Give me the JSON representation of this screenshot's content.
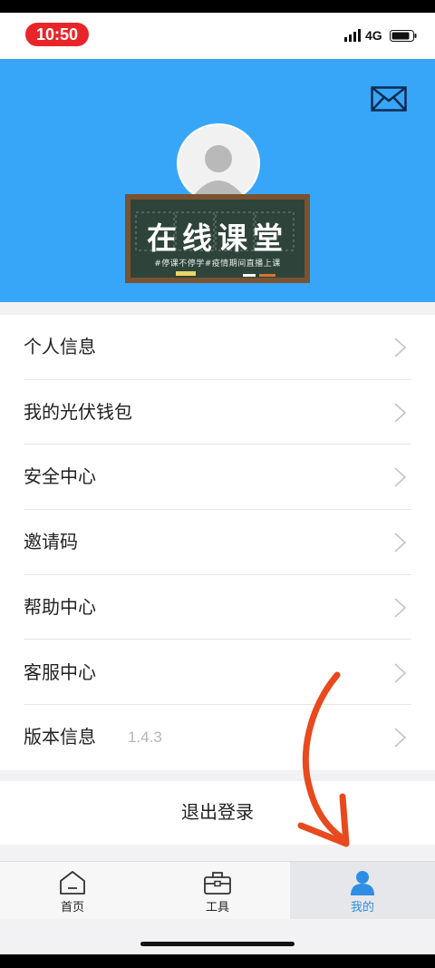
{
  "status_bar": {
    "time": "10:50",
    "network": "4G"
  },
  "header": {
    "banner_title": "在线课堂",
    "banner_subtitle": "#停课不停学#疫情期间直播上课",
    "mail_icon": "mail-icon",
    "background_color": "#38a6f8"
  },
  "menu": {
    "items": [
      {
        "label": "个人信息"
      },
      {
        "label": "我的光伏钱包"
      },
      {
        "label": "安全中心"
      },
      {
        "label": "邀请码"
      },
      {
        "label": "帮助中心"
      },
      {
        "label": "客服中心"
      },
      {
        "label": "版本信息",
        "value": "1.4.3"
      }
    ]
  },
  "logout": {
    "label": "退出登录"
  },
  "tabbar": {
    "tabs": [
      {
        "label": "首页",
        "icon": "home-icon"
      },
      {
        "label": "工具",
        "icon": "toolbox-icon"
      },
      {
        "label": "我的",
        "icon": "profile-icon",
        "active": true
      }
    ],
    "active_color": "#2d8ee3"
  },
  "annotation": {
    "arrow_color": "#e8491d"
  }
}
